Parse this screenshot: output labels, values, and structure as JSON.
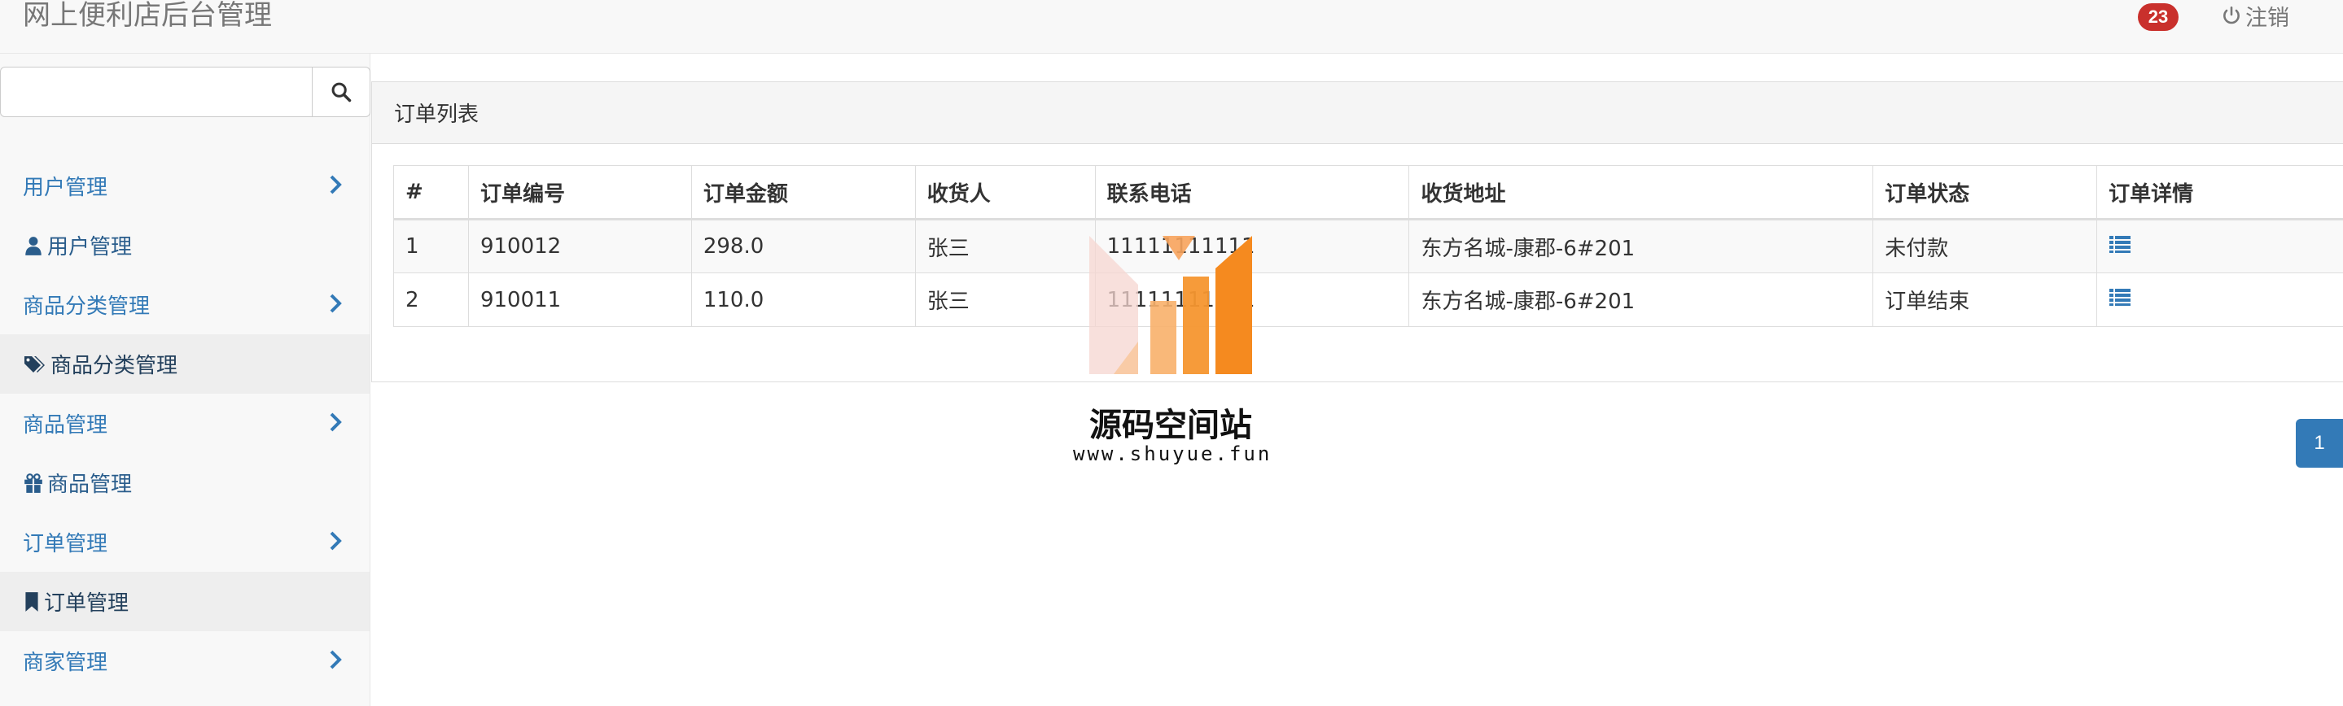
{
  "header": {
    "brand": "网上便利店后台管理",
    "badge_count": "23",
    "logout_label": "注销"
  },
  "sidebar": {
    "search": {
      "value": "",
      "placeholder": ""
    },
    "items": [
      {
        "label": "用户管理",
        "type": "group"
      },
      {
        "label": "用户管理",
        "type": "sub",
        "icon": "user-icon"
      },
      {
        "label": "商品分类管理",
        "type": "group"
      },
      {
        "label": "商品分类管理",
        "type": "sub",
        "icon": "tags-icon",
        "active": true
      },
      {
        "label": "商品管理",
        "type": "group"
      },
      {
        "label": "商品管理",
        "type": "sub",
        "icon": "gift-icon"
      },
      {
        "label": "订单管理",
        "type": "group"
      },
      {
        "label": "订单管理",
        "type": "sub",
        "icon": "bookmark-icon",
        "active": true
      },
      {
        "label": "商家管理",
        "type": "group"
      }
    ]
  },
  "panel": {
    "title": "订单列表",
    "columns": [
      "#",
      "订单编号",
      "订单金额",
      "收货人",
      "联系电话",
      "收货地址",
      "订单状态",
      "订单详情"
    ],
    "rows": [
      {
        "index": "1",
        "order_no": "910012",
        "amount": "298.0",
        "receiver": "张三",
        "phone": "11111111111",
        "address": "东方名城-康郡-6#201",
        "status": "未付款",
        "detail_icon": "list-icon"
      },
      {
        "index": "2",
        "order_no": "910011",
        "amount": "110.0",
        "receiver": "张三",
        "phone": "11111111111",
        "address": "东方名城-康郡-6#201",
        "status": "订单结束",
        "detail_icon": "list-icon"
      }
    ]
  },
  "pagination": {
    "current": "1"
  },
  "watermark": {
    "title": "源码空间站",
    "url": "www.shuyue.fun"
  },
  "colors": {
    "link": "#337ab7",
    "badge": "#c9302c",
    "watermark_orange": "#f58a1f"
  }
}
